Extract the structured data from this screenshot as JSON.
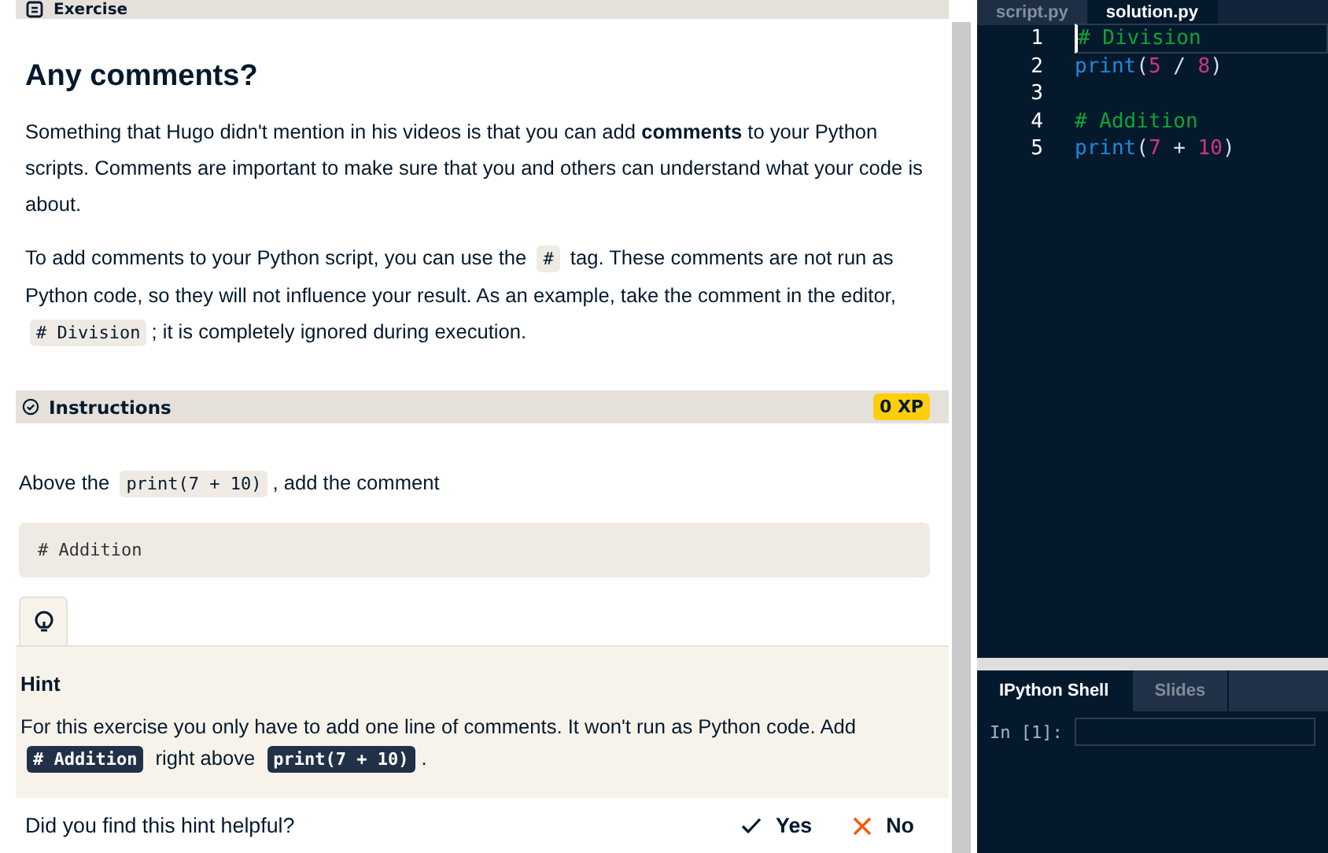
{
  "exercise_header": {
    "label": "Exercise"
  },
  "title": "Any comments?",
  "paragraphs": [
    [
      {
        "kind": "text",
        "text": "Something that Hugo didn't mention in his videos is that you can add **comments** to your Python scripts. Comments are important to make sure that you and others can understand what your code is about."
      }
    ],
    [
      {
        "kind": "text",
        "text": "To add comments to your Python script, you can use the "
      },
      {
        "kind": "code",
        "text": "#"
      },
      {
        "kind": "text",
        "text": " tag. These comments are not run as Python code, so they will not influence your result. As an example, take the comment in the editor, "
      },
      {
        "kind": "code",
        "text": "# Division"
      },
      {
        "kind": "text",
        "text": "; it is completely ignored during execution."
      }
    ]
  ],
  "instructions": {
    "label": "Instructions",
    "xp": "0 XP",
    "text": [
      {
        "kind": "text",
        "text": "Above the "
      },
      {
        "kind": "code",
        "text": "print(7 + 10)"
      },
      {
        "kind": "text",
        "text": ", add the comment"
      }
    ],
    "code_block": "# Addition"
  },
  "hint": {
    "expanded": true,
    "title": "Hint",
    "text": [
      {
        "kind": "text",
        "text": "For this exercise you only have to add one line of comments. It won't run as Python code. Add "
      },
      {
        "kind": "code",
        "text": "# Addition"
      },
      {
        "kind": "text",
        "text": " right above "
      },
      {
        "kind": "code",
        "text": "print(7 + 10)"
      },
      {
        "kind": "text",
        "text": "."
      }
    ]
  },
  "feedback": {
    "question": "Did you find this hint helpful?",
    "yes": "Yes",
    "no": "No"
  },
  "editor": {
    "tabs": [
      {
        "label": "script.py",
        "selected": false
      },
      {
        "label": "solution.py",
        "selected": true
      }
    ],
    "lines": [
      {
        "number": "1",
        "active": true,
        "tokens": [
          {
            "kind": "comment",
            "text": "# Division"
          }
        ]
      },
      {
        "number": "2",
        "active": false,
        "tokens": [
          {
            "kind": "func",
            "text": "print"
          },
          {
            "kind": "plain",
            "text": "("
          },
          {
            "kind": "number",
            "text": "5"
          },
          {
            "kind": "plain",
            "text": " / "
          },
          {
            "kind": "number",
            "text": "8"
          },
          {
            "kind": "plain",
            "text": ")"
          }
        ]
      },
      {
        "number": "3",
        "active": false
      },
      {
        "number": "4",
        "active": false,
        "tokens": [
          {
            "kind": "comment",
            "text": "# Addition"
          }
        ]
      },
      {
        "number": "5",
        "active": false,
        "tokens": [
          {
            "kind": "func",
            "text": "print"
          },
          {
            "kind": "plain",
            "text": "("
          },
          {
            "kind": "number",
            "text": "7"
          },
          {
            "kind": "plain",
            "text": " + "
          },
          {
            "kind": "number",
            "text": "10"
          },
          {
            "kind": "plain",
            "text": ")"
          }
        ]
      }
    ]
  },
  "shell": {
    "tabs": [
      {
        "label": "IPython Shell",
        "selected": true
      },
      {
        "label": "Slides",
        "selected": false
      }
    ],
    "prompt": "In [1]:"
  }
}
